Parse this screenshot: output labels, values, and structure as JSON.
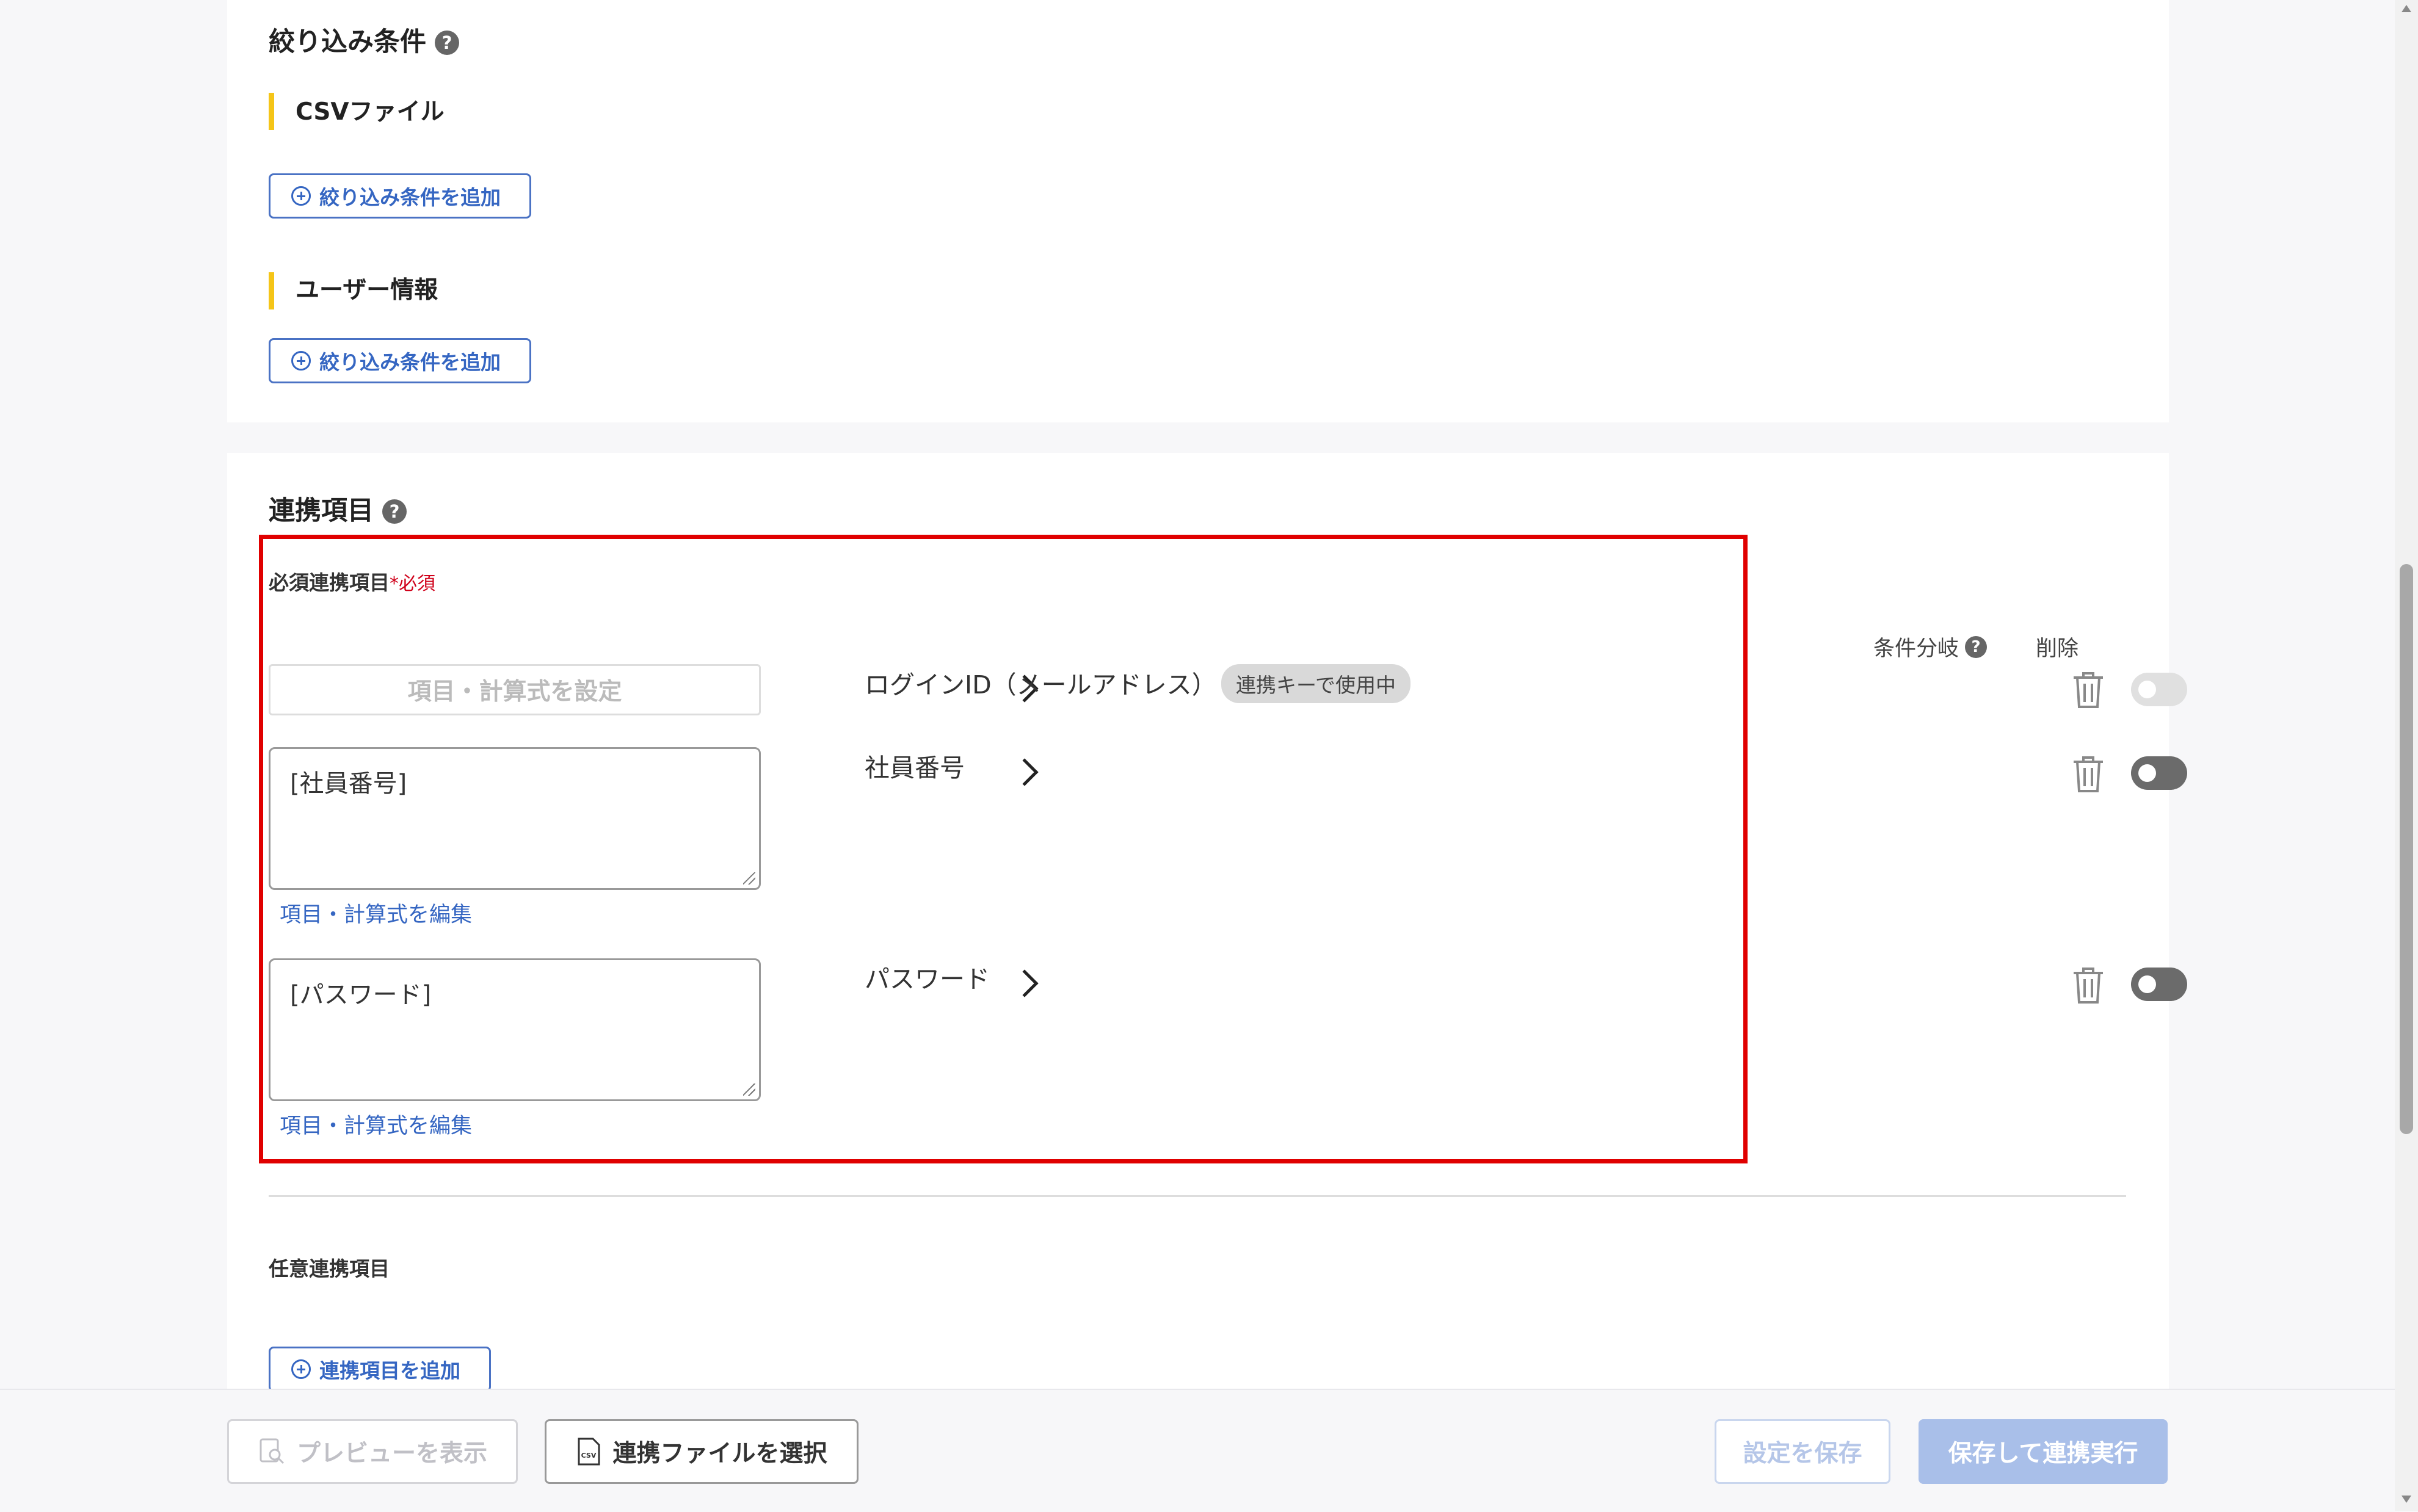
{
  "filter_section": {
    "title": "絞り込み条件",
    "groups": [
      {
        "label": "CSVファイル",
        "add_button": "絞り込み条件を追加"
      },
      {
        "label": "ユーザー情報",
        "add_button": "絞り込み条件を追加"
      }
    ]
  },
  "mapping_section": {
    "title": "連携項目",
    "required_label": "必須連携項目",
    "required_mark": "*",
    "required_tag": "必須",
    "columns": {
      "condition_branch": "条件分岐",
      "delete": "削除"
    },
    "rows": [
      {
        "source_placeholder": "項目・計算式を設定",
        "target": "ログインID（メールアドレス）",
        "badge": "連携キーで使用中",
        "toggle_on": false
      },
      {
        "source_value": "[社員番号]",
        "edit_link": "項目・計算式を編集",
        "target": "社員番号",
        "toggle_on": true
      },
      {
        "source_value": "[パスワード]",
        "edit_link": "項目・計算式を編集",
        "target": "パスワード",
        "toggle_on": true
      }
    ],
    "optional_label": "任意連携項目",
    "add_item_button": "連携項目を追加"
  },
  "footer": {
    "preview_button": "プレビューを表示",
    "select_file_button": "連携ファイルを選択",
    "save_button": "設定を保存",
    "save_run_button": "保存して連携実行"
  },
  "colors": {
    "accent": "#3566c2",
    "highlight": "#e00000",
    "section_bar": "#f5c518",
    "required": "#d0021b"
  }
}
